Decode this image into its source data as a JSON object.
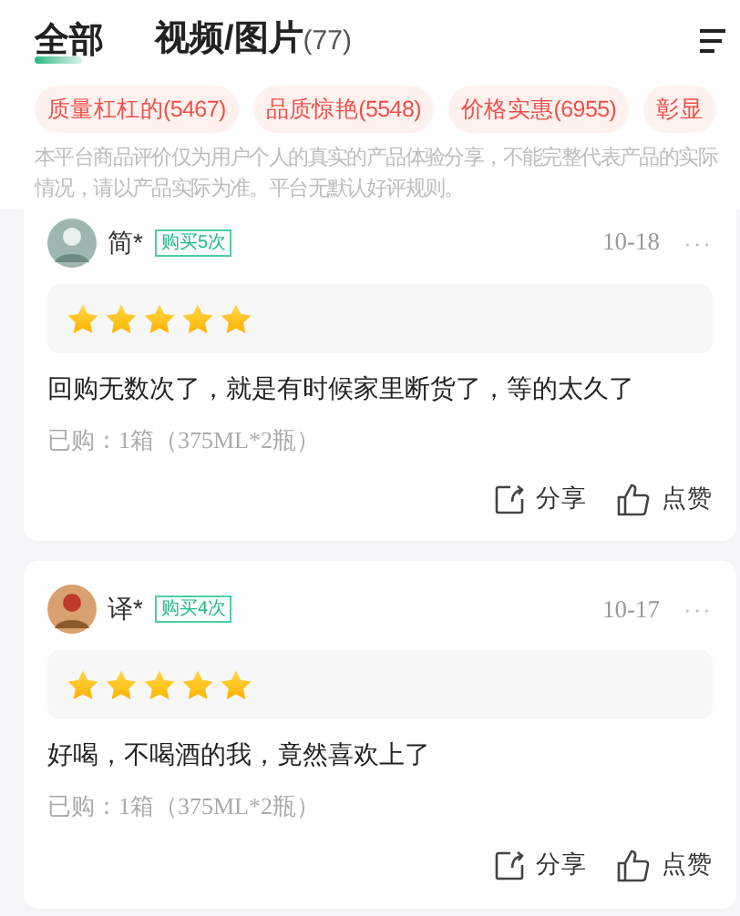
{
  "tabs": [
    {
      "label": "全部",
      "selected": true
    },
    {
      "label": "视频/图片",
      "count": "(77)",
      "selected": false
    }
  ],
  "tags": [
    "质量杠杠的(5467)",
    "品质惊艳(5548)",
    "价格实惠(6955)",
    "彰显"
  ],
  "disclaimer": "本平台商品评价仅为用户个人的真实的产品体验分享，不能完整代表产品的实际情况，请以产品实际为准。平台无默认好评规则。",
  "reviews": [
    {
      "user": "简*",
      "badge": "购买5次",
      "date": "10-18",
      "more": "···",
      "stars": 5,
      "text": "回购无数次了，就是有时候家里断货了，等的太久了",
      "purchased": "已购：1箱（375ML*2瓶）",
      "share": "分享",
      "like": "点赞"
    },
    {
      "user": "译*",
      "badge": "购买4次",
      "date": "10-17",
      "more": "···",
      "stars": 5,
      "text": "好喝，不喝酒的我，竟然喜欢上了",
      "purchased": "已购：1箱（375ML*2瓶）",
      "share": "分享",
      "like": "点赞"
    }
  ]
}
